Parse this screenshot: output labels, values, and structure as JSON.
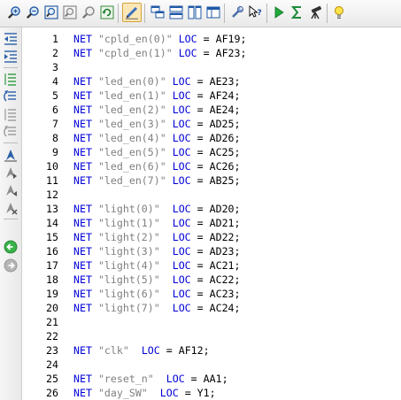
{
  "toolbar": {
    "buttons": [
      {
        "id": "zoom-in",
        "icon": "zoom-in-icon",
        "active": false
      },
      {
        "id": "zoom-out",
        "icon": "zoom-out-icon",
        "active": false
      },
      {
        "id": "zoom-fit",
        "icon": "zoom-fit-icon",
        "active": false
      },
      {
        "id": "zoom-full",
        "icon": "zoom-full-icon",
        "active": false
      },
      {
        "id": "zoom-select",
        "icon": "zoom-select-icon",
        "active": false
      },
      {
        "id": "refresh",
        "icon": "refresh-icon",
        "active": false
      },
      {
        "id": "edit-mode",
        "icon": "edit-pencil-icon",
        "active": true
      },
      {
        "id": "cascade",
        "icon": "cascade-windows-icon",
        "active": false
      },
      {
        "id": "tile-horizontal",
        "icon": "tile-horizontal-icon",
        "active": false
      },
      {
        "id": "tile-vertical",
        "icon": "tile-vertical-icon",
        "active": false
      },
      {
        "id": "maximize-panes",
        "icon": "maximize-panes-icon",
        "active": false
      },
      {
        "id": "properties",
        "icon": "wrench-icon",
        "active": false
      },
      {
        "id": "context-help",
        "icon": "help-cursor-icon",
        "active": false
      },
      {
        "id": "run",
        "icon": "run-icon",
        "active": false
      },
      {
        "id": "sum",
        "icon": "sigma-icon",
        "active": false
      },
      {
        "id": "probe",
        "icon": "telescope-icon",
        "active": false
      },
      {
        "id": "tips",
        "icon": "lightbulb-icon",
        "active": false
      }
    ]
  },
  "sidebar": {
    "buttons": [
      {
        "id": "unindent",
        "icon": "unindent-icon"
      },
      {
        "id": "indent",
        "icon": "indent-icon"
      },
      {
        "id": "comment",
        "icon": "comment-lines-icon"
      },
      {
        "id": "uncomment",
        "icon": "uncomment-lines-icon"
      },
      {
        "id": "toggle-comment",
        "icon": "toggle-comment-icon"
      },
      {
        "id": "undo-format",
        "icon": "undo-format-icon"
      },
      {
        "id": "bookmark-toggle",
        "icon": "bookmark-toggle-icon"
      },
      {
        "id": "bookmark-next",
        "icon": "bookmark-next-icon"
      },
      {
        "id": "bookmark-prev",
        "icon": "bookmark-prev-icon"
      },
      {
        "id": "bookmark-clear",
        "icon": "bookmark-clear-icon"
      },
      {
        "id": "go-back",
        "icon": "go-back-icon"
      },
      {
        "id": "go-forward",
        "icon": "go-forward-icon"
      }
    ]
  },
  "editor": {
    "lines": [
      {
        "n": "1",
        "kw": "NET",
        "str": "\"cpld_en(0)\"",
        "loc": "LOC",
        "rest": "= AF19;",
        "gap1": " ",
        "gap2": " "
      },
      {
        "n": "2",
        "kw": "NET",
        "str": "\"cpld_en(1)\"",
        "loc": "LOC",
        "rest": "= AF23;",
        "gap1": " ",
        "gap2": " "
      },
      {
        "n": "3"
      },
      {
        "n": "4",
        "kw": "NET",
        "str": "\"led_en(0)\"",
        "loc": "LOC",
        "rest": "= AE23;",
        "gap1": " ",
        "gap2": " "
      },
      {
        "n": "5",
        "kw": "NET",
        "str": "\"led_en(1)\"",
        "loc": "LOC",
        "rest": "= AF24;",
        "gap1": " ",
        "gap2": " "
      },
      {
        "n": "6",
        "kw": "NET",
        "str": "\"led_en(2)\"",
        "loc": "LOC",
        "rest": "= AE24;",
        "gap1": " ",
        "gap2": " "
      },
      {
        "n": "7",
        "kw": "NET",
        "str": "\"led_en(3)\"",
        "loc": "LOC",
        "rest": "= AD25;",
        "gap1": " ",
        "gap2": " "
      },
      {
        "n": "8",
        "kw": "NET",
        "str": "\"led_en(4)\"",
        "loc": "LOC",
        "rest": "= AD26;",
        "gap1": " ",
        "gap2": " "
      },
      {
        "n": "9",
        "kw": "NET",
        "str": "\"led_en(5)\"",
        "loc": "LOC",
        "rest": "= AC25;",
        "gap1": " ",
        "gap2": " "
      },
      {
        "n": "10",
        "kw": "NET",
        "str": "\"led_en(6)\"",
        "loc": "LOC",
        "rest": "= AC26;",
        "gap1": " ",
        "gap2": " "
      },
      {
        "n": "11",
        "kw": "NET",
        "str": "\"led_en(7)\"",
        "loc": "LOC",
        "rest": "= AB25;",
        "gap1": " ",
        "gap2": " "
      },
      {
        "n": "12"
      },
      {
        "n": "13",
        "kw": "NET",
        "str": "\"light(0)\"",
        "loc": "LOC",
        "rest": "= AD20;",
        "gap1": " ",
        "gap2": "  "
      },
      {
        "n": "14",
        "kw": "NET",
        "str": "\"light(1)\"",
        "loc": "LOC",
        "rest": "= AD21;",
        "gap1": " ",
        "gap2": "  "
      },
      {
        "n": "15",
        "kw": "NET",
        "str": "\"light(2)\"",
        "loc": "LOC",
        "rest": "= AD22;",
        "gap1": " ",
        "gap2": "  "
      },
      {
        "n": "16",
        "kw": "NET",
        "str": "\"light(3)\"",
        "loc": "LOC",
        "rest": "= AD23;",
        "gap1": " ",
        "gap2": "  "
      },
      {
        "n": "17",
        "kw": "NET",
        "str": "\"light(4)\"",
        "loc": "LOC",
        "rest": "= AC21;",
        "gap1": " ",
        "gap2": "  "
      },
      {
        "n": "18",
        "kw": "NET",
        "str": "\"light(5)\"",
        "loc": "LOC",
        "rest": "= AC22;",
        "gap1": " ",
        "gap2": "  "
      },
      {
        "n": "19",
        "kw": "NET",
        "str": "\"light(6)\"",
        "loc": "LOC",
        "rest": "= AC23;",
        "gap1": " ",
        "gap2": "  "
      },
      {
        "n": "20",
        "kw": "NET",
        "str": "\"light(7)\"",
        "loc": "LOC",
        "rest": "= AC24;",
        "gap1": " ",
        "gap2": "  "
      },
      {
        "n": "21"
      },
      {
        "n": "22"
      },
      {
        "n": "23",
        "kw": "NET",
        "str": "\"clk\"",
        "loc": "LOC",
        "rest": "= AF12;",
        "gap1": " ",
        "gap2": "  "
      },
      {
        "n": "24"
      },
      {
        "n": "25",
        "kw": "NET",
        "str": "\"reset_n\"",
        "loc": "LOC",
        "rest": "= AA1;",
        "gap1": " ",
        "gap2": "  "
      },
      {
        "n": "26",
        "kw": "NET",
        "str": "\"day_SW\"",
        "loc": "LOC",
        "rest": "= Y1;",
        "gap1": " ",
        "gap2": "  "
      }
    ]
  },
  "colors": {
    "keyword": "#0000d8",
    "string": "#808080",
    "text": "#000000",
    "active_button": "#fbe7b6"
  }
}
